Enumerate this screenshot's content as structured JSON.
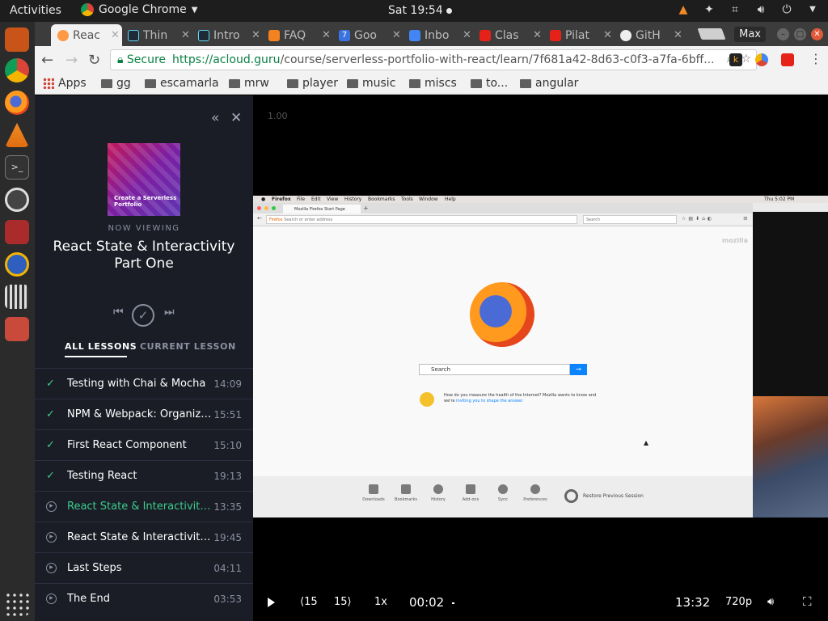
{
  "topbar": {
    "activities": "Activities",
    "app_name": "Google Chrome",
    "clock": "Sat 19:54"
  },
  "tabs": [
    "Reac",
    "Thin",
    "Intro",
    "FAQ",
    "Goo",
    "Inbo",
    "Clas",
    "Pilat",
    "GitH"
  ],
  "chrome": {
    "profile": "Max",
    "secure_label": "Secure",
    "url_host": "https://acloud.guru",
    "url_path": "/course/serverless-portfolio-with-react/learn/7f681a42-8d63-c0f3-a7fa-6bff..."
  },
  "bookmarks": [
    "Apps",
    "gg",
    "escamarla",
    "mrw",
    "player",
    "music",
    "miscs",
    "to...",
    "angular"
  ],
  "sidebar": {
    "cover_title": "Create a Serverless Portfolio",
    "now_viewing": "NOW VIEWING",
    "lesson_title_line1": "React State & Interactivity",
    "lesson_title_line2": "Part One",
    "tabs": [
      "ALL LESSONS",
      "CURRENT LESSON"
    ]
  },
  "lessons": [
    {
      "title": "Testing with Chai & Mocha",
      "duration": "14:09",
      "status": "complete"
    },
    {
      "title": "NPM & Webpack: Organizing ...",
      "duration": "15:51",
      "status": "complete"
    },
    {
      "title": "First React Component",
      "duration": "15:10",
      "status": "complete"
    },
    {
      "title": "Testing React",
      "duration": "19:13",
      "status": "complete"
    },
    {
      "title": "React State & Interactivity Pa...",
      "duration": "13:35",
      "status": "current"
    },
    {
      "title": "React State & Interactivity Pa...",
      "duration": "19:45",
      "status": "pending"
    },
    {
      "title": "Last Steps",
      "duration": "04:11",
      "status": "pending"
    },
    {
      "title": "The End",
      "duration": "03:53",
      "status": "pending"
    }
  ],
  "player": {
    "overlay_speed": "1.00",
    "rewind": "⟨15",
    "forward": "15⟩",
    "speed": "1x",
    "current_time": "00:02",
    "duration": "13:32",
    "quality": "720p"
  },
  "video_frame": {
    "menubar": [
      "Firefox",
      "File",
      "Edit",
      "View",
      "History",
      "Bookmarks",
      "Tools",
      "Window",
      "Help"
    ],
    "clock": "Thu 5:02 PM",
    "ff_tab": "Mozilla Firefox Start Page",
    "ff_url_badge": "Firefox",
    "ff_url_placeholder": "Search or enter address",
    "ff_search_small": "Search",
    "mozilla": "mozilla",
    "ff_search_placeholder": "Search",
    "snippet_main": "How do you measure the health of the Internet? Mozilla wants to know and we're",
    "snippet_link": "inviting you to shape the answer.",
    "launcher": [
      "Downloads",
      "Bookmarks",
      "History",
      "Add-ons",
      "Sync",
      "Preferences"
    ],
    "restore": "Restore Previous Session"
  },
  "colors": {
    "sidebar_bg": "#1a1d26",
    "accent_green": "#3ccc8c",
    "secure_green": "#0b8043"
  }
}
